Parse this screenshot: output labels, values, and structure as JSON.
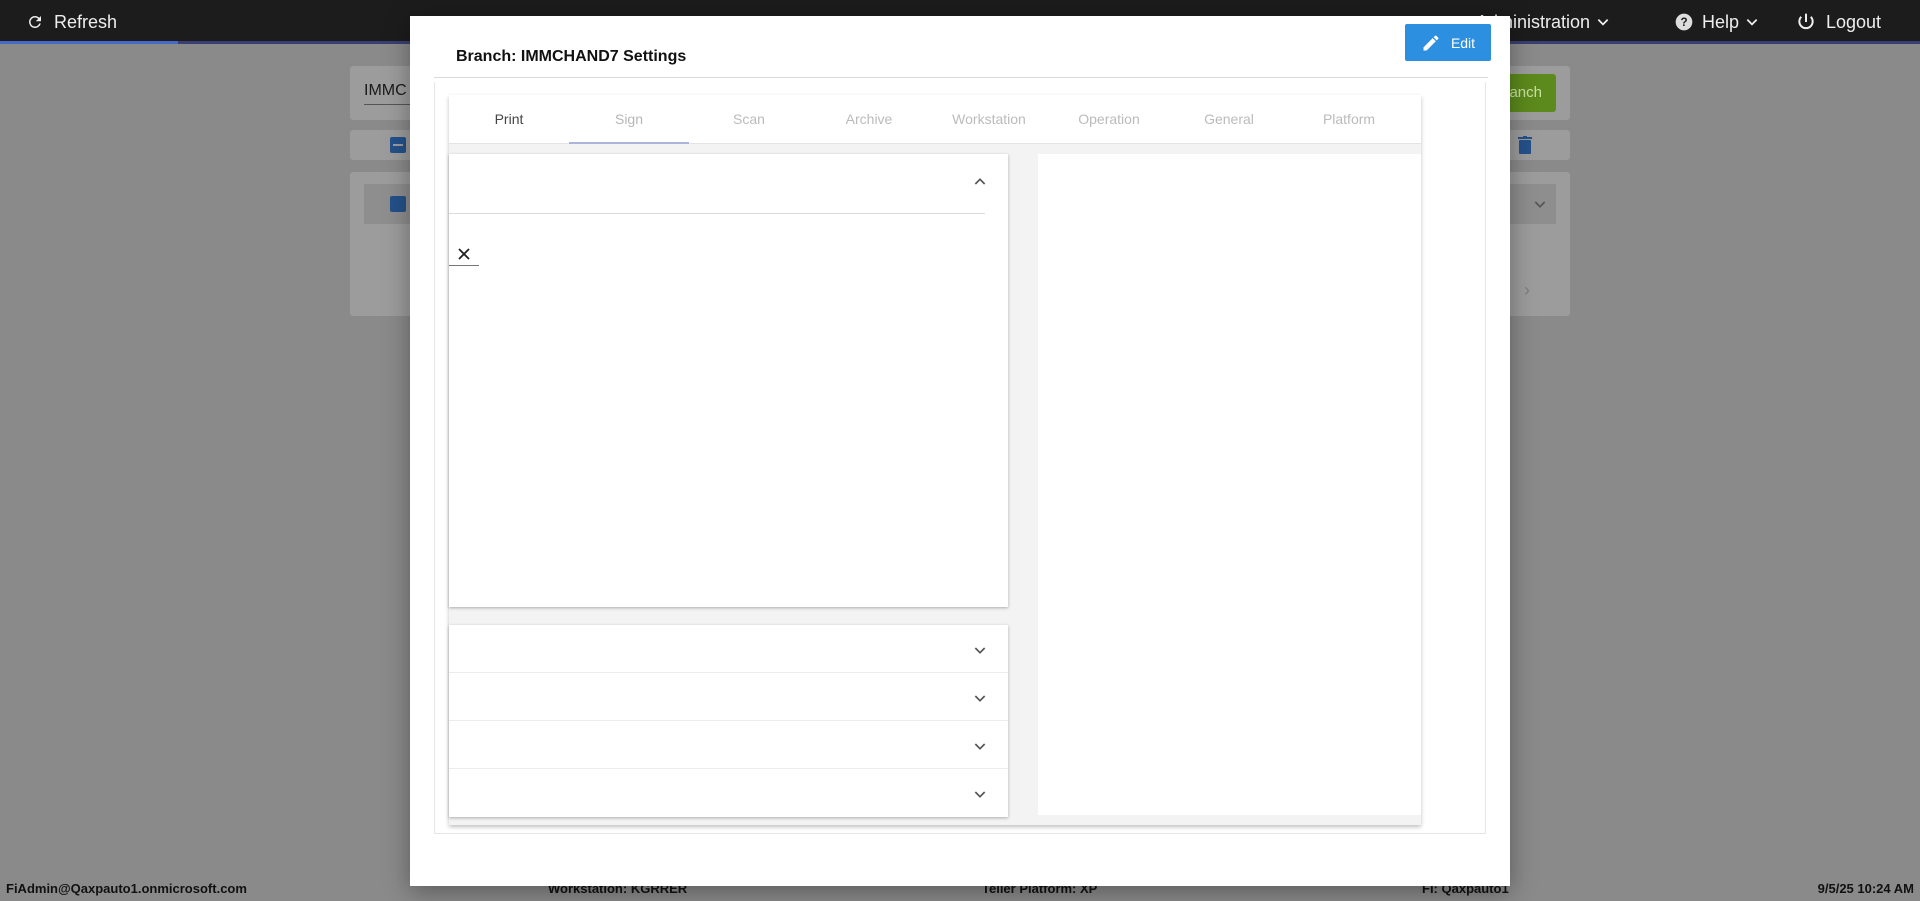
{
  "topbar": {
    "refresh_label": "Refresh",
    "administration_label": "Administration",
    "help_label": "Help",
    "logout_label": "Logout"
  },
  "background": {
    "search_value": "IMMC",
    "add_button_label": "anch"
  },
  "modal": {
    "title": "Branch: IMMCHAND7 Settings",
    "edit_label": "Edit",
    "tabs": [
      {
        "label": "Print"
      },
      {
        "label": "Sign"
      },
      {
        "label": "Scan"
      },
      {
        "label": "Archive"
      },
      {
        "label": "Workstation"
      },
      {
        "label": "Operation"
      },
      {
        "label": "General"
      },
      {
        "label": "Platform"
      }
    ],
    "selected_tab": "Sign"
  },
  "statusbar": {
    "user": "FiAdmin@Qaxpauto1.onmicrosoft.com",
    "workstation": "Workstation: KGRRER",
    "teller_platform": "Teller Platform: XP",
    "fi": "FI: Qaxpauto1",
    "datetime": "9/5/25 10:24 AM"
  },
  "colors": {
    "edit_button": "#2d8fe0",
    "tab_indicator": "#aab4dc",
    "topbar": "#1c1c1c",
    "progress": "#4568c9"
  },
  "icons": {
    "refresh": "refresh-icon",
    "administration": "chevron-down-icon",
    "help": "help-circle-icon",
    "logout": "power-icon",
    "edit": "pencil-icon",
    "collapse": "chevron-up-icon",
    "expand": "chevron-down-icon",
    "clear": "close-icon"
  }
}
